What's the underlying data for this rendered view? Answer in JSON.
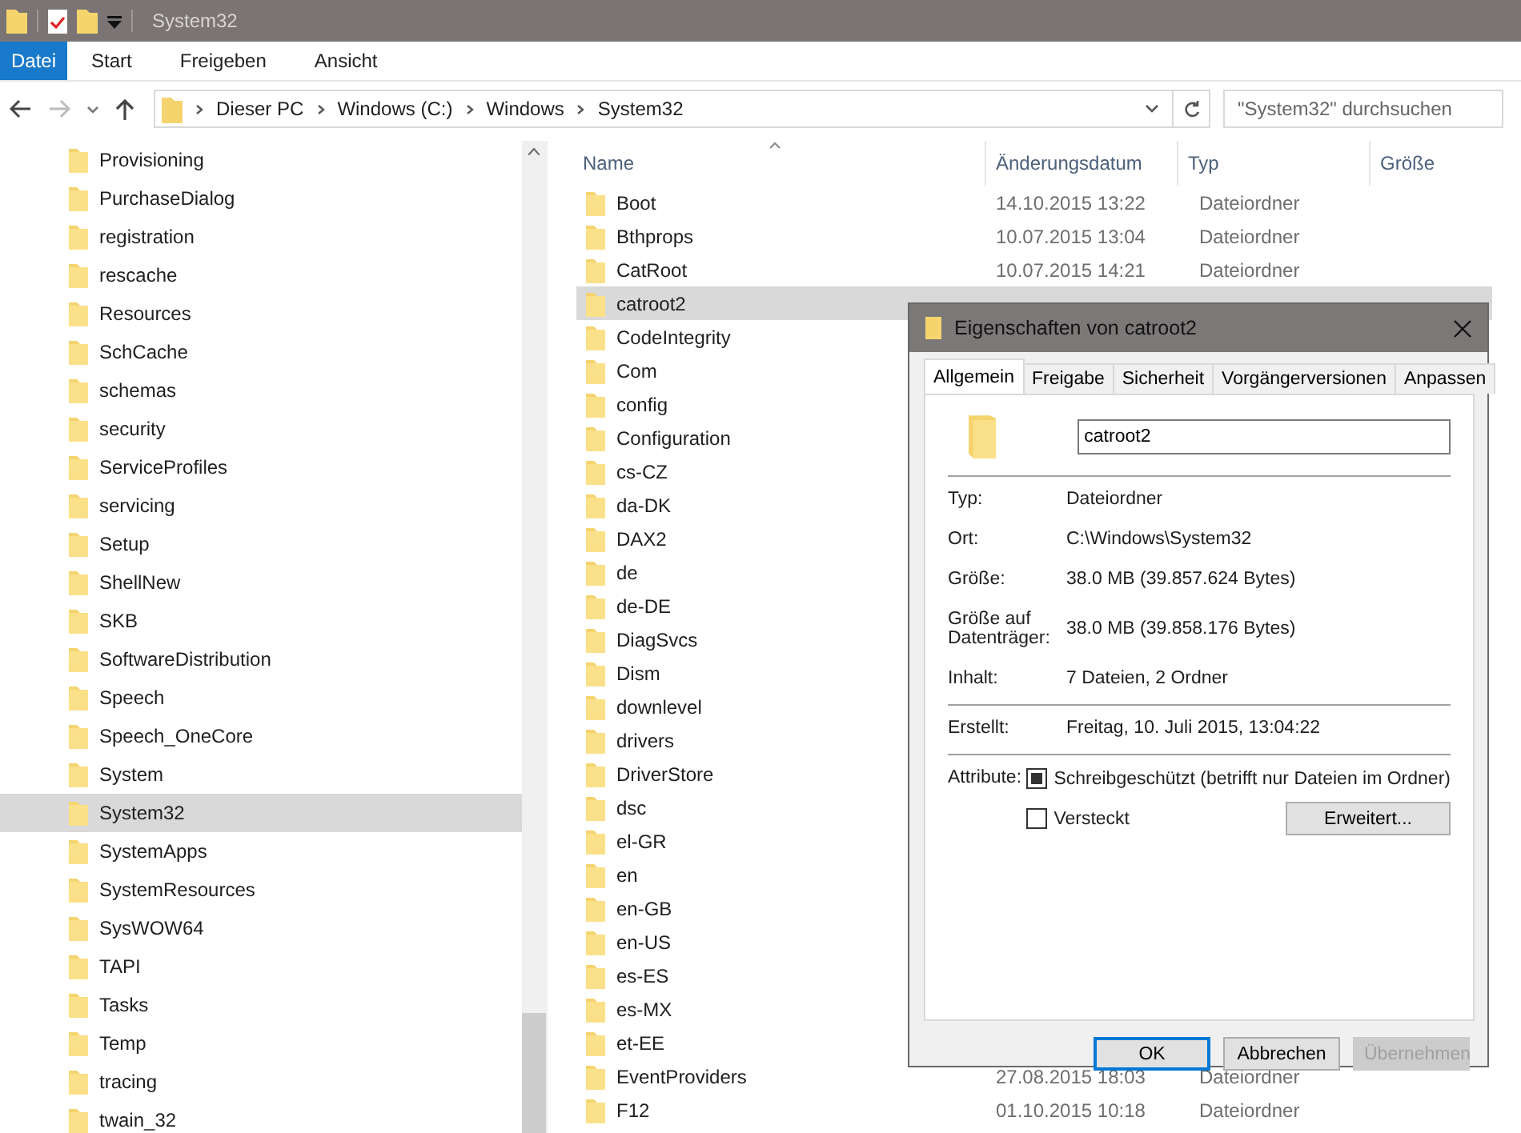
{
  "window": {
    "title": "System32"
  },
  "ribbon_tabs": [
    {
      "label": "Datei",
      "selected": true
    },
    {
      "label": "Start",
      "selected": false
    },
    {
      "label": "Freigeben",
      "selected": false
    },
    {
      "label": "Ansicht",
      "selected": false
    }
  ],
  "breadcrumb": [
    "Dieser PC",
    "Windows (C:)",
    "Windows",
    "System32"
  ],
  "search": {
    "placeholder": "\"System32\" durchsuchen"
  },
  "sidebar": {
    "items": [
      {
        "label": "Provisioning",
        "selected": false
      },
      {
        "label": "PurchaseDialog",
        "selected": false
      },
      {
        "label": "registration",
        "selected": false
      },
      {
        "label": "rescache",
        "selected": false
      },
      {
        "label": "Resources",
        "selected": false
      },
      {
        "label": "SchCache",
        "selected": false
      },
      {
        "label": "schemas",
        "selected": false
      },
      {
        "label": "security",
        "selected": false
      },
      {
        "label": "ServiceProfiles",
        "selected": false
      },
      {
        "label": "servicing",
        "selected": false
      },
      {
        "label": "Setup",
        "selected": false
      },
      {
        "label": "ShellNew",
        "selected": false
      },
      {
        "label": "SKB",
        "selected": false
      },
      {
        "label": "SoftwareDistribution",
        "selected": false
      },
      {
        "label": "Speech",
        "selected": false
      },
      {
        "label": "Speech_OneCore",
        "selected": false
      },
      {
        "label": "System",
        "selected": false
      },
      {
        "label": "System32",
        "selected": true
      },
      {
        "label": "SystemApps",
        "selected": false
      },
      {
        "label": "SystemResources",
        "selected": false
      },
      {
        "label": "SysWOW64",
        "selected": false
      },
      {
        "label": "TAPI",
        "selected": false
      },
      {
        "label": "Tasks",
        "selected": false
      },
      {
        "label": "Temp",
        "selected": false
      },
      {
        "label": "tracing",
        "selected": false
      },
      {
        "label": "twain_32",
        "selected": false
      }
    ]
  },
  "table": {
    "columns": [
      "Name",
      "Änderungsdatum",
      "Typ",
      "Größe"
    ],
    "rows": [
      {
        "name": "Boot",
        "date": "14.10.2015 13:22",
        "type": "Dateiordner",
        "selected": false
      },
      {
        "name": "Bthprops",
        "date": "10.07.2015 13:04",
        "type": "Dateiordner",
        "selected": false
      },
      {
        "name": "CatRoot",
        "date": "10.07.2015 14:21",
        "type": "Dateiordner",
        "selected": false
      },
      {
        "name": "catroot2",
        "selected": true
      },
      {
        "name": "CodeIntegrity",
        "selected": false
      },
      {
        "name": "Com",
        "selected": false
      },
      {
        "name": "config",
        "selected": false
      },
      {
        "name": "Configuration",
        "selected": false
      },
      {
        "name": "cs-CZ",
        "selected": false
      },
      {
        "name": "da-DK",
        "selected": false
      },
      {
        "name": "DAX2",
        "selected": false
      },
      {
        "name": "de",
        "selected": false
      },
      {
        "name": "de-DE",
        "selected": false
      },
      {
        "name": "DiagSvcs",
        "selected": false
      },
      {
        "name": "Dism",
        "selected": false
      },
      {
        "name": "downlevel",
        "selected": false
      },
      {
        "name": "drivers",
        "selected": false
      },
      {
        "name": "DriverStore",
        "selected": false
      },
      {
        "name": "dsc",
        "selected": false
      },
      {
        "name": "el-GR",
        "selected": false
      },
      {
        "name": "en",
        "selected": false
      },
      {
        "name": "en-GB",
        "selected": false
      },
      {
        "name": "en-US",
        "selected": false
      },
      {
        "name": "es-ES",
        "selected": false
      },
      {
        "name": "es-MX",
        "selected": false
      },
      {
        "name": "et-EE",
        "selected": false
      },
      {
        "name": "EventProviders",
        "date": "27.08.2015 18:03",
        "type": "Dateiordner",
        "selected": false
      },
      {
        "name": "F12",
        "date": "01.10.2015 10:18",
        "type": "Dateiordner",
        "selected": false
      }
    ]
  },
  "dialog": {
    "title": "Eigenschaften von catroot2",
    "tabs": [
      {
        "label": "Allgemein",
        "selected": true
      },
      {
        "label": "Freigabe",
        "selected": false
      },
      {
        "label": "Sicherheit",
        "selected": false
      },
      {
        "label": "Vorgängerversionen",
        "selected": false
      },
      {
        "label": "Anpassen",
        "selected": false
      }
    ],
    "name_value": "catroot2",
    "props_1": [
      {
        "label": "Typ:",
        "value": "Dateiordner"
      },
      {
        "label": "Ort:",
        "value": "C:\\Windows\\System32"
      },
      {
        "label": "Größe:",
        "value": "38.0 MB (39.857.624 Bytes)"
      },
      {
        "label": "Größe auf Datenträger:",
        "value": "38.0 MB (39.858.176 Bytes)"
      },
      {
        "label": "Inhalt:",
        "value": "7 Dateien, 2 Ordner"
      }
    ],
    "props_2": [
      {
        "label": "Erstellt:",
        "value": "Freitag, 10. Juli 2015, 13:04:22"
      }
    ],
    "attributes_label": "Attribute:",
    "attributes": [
      {
        "label": "Schreibgeschützt (betrifft nur Dateien im Ordner)",
        "checked": true
      },
      {
        "label": "Versteckt",
        "checked": false
      }
    ],
    "advanced_button": "Erweitert...",
    "buttons": [
      {
        "label": "OK",
        "kind": "default",
        "disabled": false
      },
      {
        "label": "Abbrechen",
        "kind": "normal",
        "disabled": false
      },
      {
        "label": "Übernehmen",
        "kind": "normal",
        "disabled": true
      }
    ]
  }
}
